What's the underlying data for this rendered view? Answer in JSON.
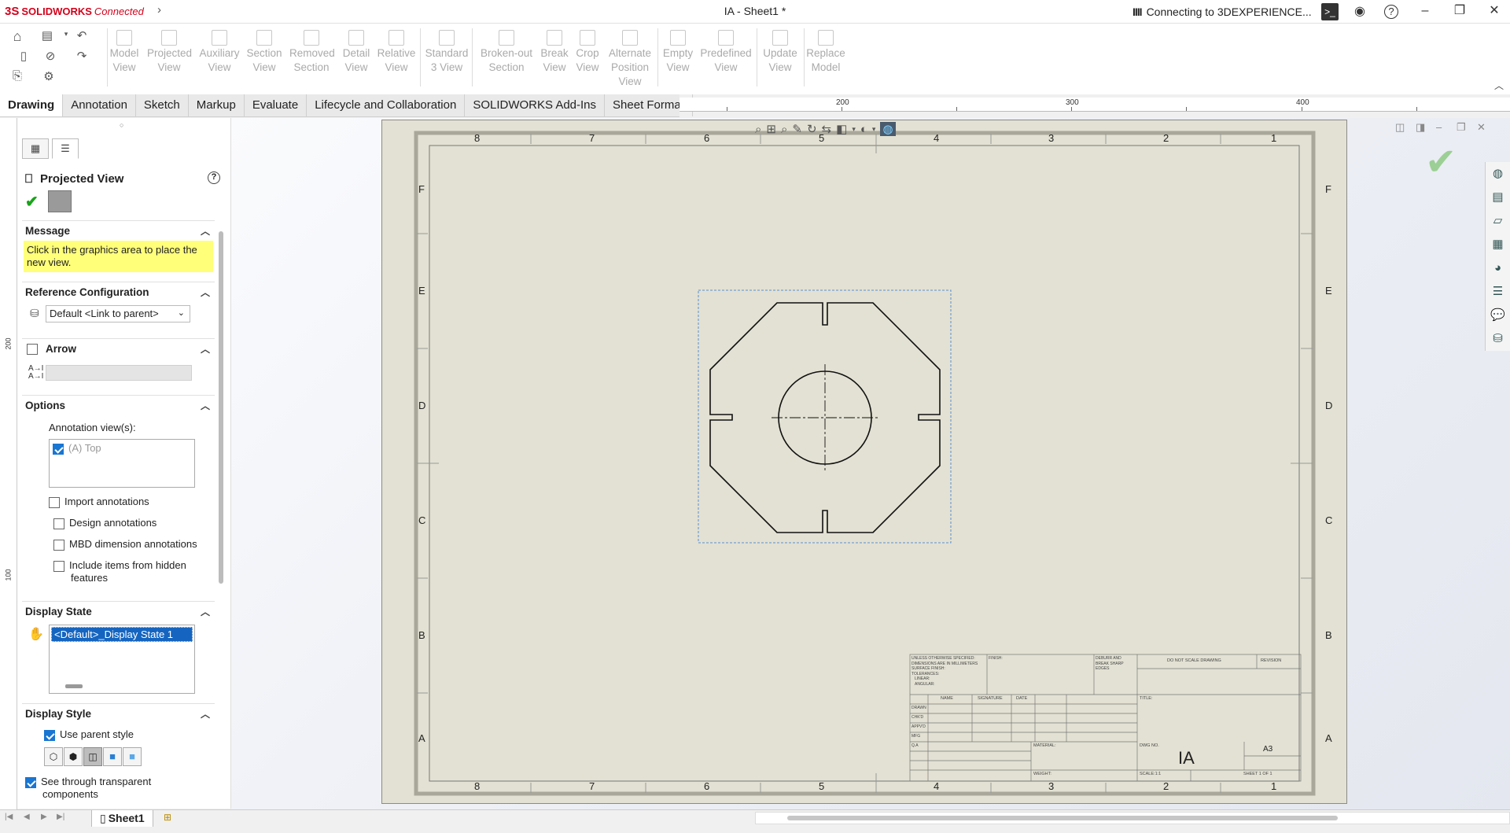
{
  "app": {
    "brand_ds": "3S",
    "brand_solidworks": "SOLIDWORKS",
    "brand_connected": "Connected",
    "document_title": "IA - Sheet1 *",
    "connection_status": "Connecting to 3DEXPERIENCE...",
    "connection_bars": "IIII"
  },
  "toolbar": {
    "tools": [
      {
        "line1": "Model",
        "line2": "View",
        "line3": ""
      },
      {
        "line1": "Projected",
        "line2": "View",
        "line3": ""
      },
      {
        "line1": "Auxiliary",
        "line2": "View",
        "line3": ""
      },
      {
        "line1": "Section",
        "line2": "View",
        "line3": ""
      },
      {
        "line1": "Removed",
        "line2": "Section",
        "line3": ""
      },
      {
        "line1": "Detail",
        "line2": "View",
        "line3": ""
      },
      {
        "line1": "Relative",
        "line2": "View",
        "line3": ""
      },
      {
        "line1": "Standard",
        "line2": "3 View",
        "line3": ""
      },
      {
        "line1": "Broken-out",
        "line2": "Section",
        "line3": ""
      },
      {
        "line1": "Break",
        "line2": "View",
        "line3": ""
      },
      {
        "line1": "Crop",
        "line2": "View",
        "line3": ""
      },
      {
        "line1": "Alternate",
        "line2": "Position",
        "line3": "View"
      },
      {
        "line1": "Empty",
        "line2": "View",
        "line3": ""
      },
      {
        "line1": "Predefined",
        "line2": "View",
        "line3": ""
      },
      {
        "line1": "Update",
        "line2": "View",
        "line3": ""
      },
      {
        "line1": "Replace",
        "line2": "Model",
        "line3": ""
      }
    ]
  },
  "tabs": [
    "Drawing",
    "Annotation",
    "Sketch",
    "Markup",
    "Evaluate",
    "Lifecycle and Collaboration",
    "SOLIDWORKS Add-Ins",
    "Sheet Format"
  ],
  "ruler": {
    "labels": [
      "200",
      "300",
      "400"
    ]
  },
  "vruler": {
    "labels": [
      "200",
      "100"
    ]
  },
  "panel": {
    "title": "Projected View",
    "help": "?",
    "message_header": "Message",
    "message_text": "Click in the graphics area to place the new view.",
    "refconfig_header": "Reference Configuration",
    "refconfig_value": "Default <Link to parent>",
    "arrow_header": "Arrow",
    "options_header": "Options",
    "annotation_views_label": "Annotation view(s):",
    "annotation_view_item": "(A) Top",
    "import_annotations": "Import annotations",
    "design_annotations": "Design annotations",
    "mbd_annotations": "MBD dimension annotations",
    "hidden_items_1": "Include items from hidden",
    "hidden_items_2": "features",
    "display_state_header": "Display State",
    "display_state_value": "<Default>_Display State 1",
    "display_style_header": "Display Style",
    "use_parent_style": "Use parent style",
    "see_through_1": "See through transparent",
    "see_through_2": "components"
  },
  "sheet": {
    "zones_x": [
      "8",
      "7",
      "6",
      "5",
      "4",
      "3",
      "2",
      "1"
    ],
    "zones_y": [
      "F",
      "E",
      "D",
      "C",
      "B",
      "A"
    ],
    "title_block": {
      "unless": "UNLESS OTHERWISE SPECIFIED:",
      "dims": "DIMENSIONS ARE IN MILLIMETERS",
      "surface": "SURFACE FINISH:",
      "tolerances": "TOLERANCES:",
      "linear": "LINEAR:",
      "angular": "ANGULAR:",
      "finish": "FINISH:",
      "deburr1": "DEBURR AND",
      "deburr2": "BREAK SHARP",
      "deburr3": "EDGES",
      "do_not_scale": "DO NOT SCALE DRAWING",
      "revision": "REVISION",
      "name": "NAME",
      "signature": "SIGNATURE",
      "date": "DATE",
      "title": "TITLE:",
      "drawn": "DRAWN",
      "chkd": "CHK'D",
      "appvd": "APPV'D",
      "mfg": "MFG",
      "qa": "Q.A",
      "material": "MATERIAL:",
      "dwg_no": "DWG NO.",
      "dwg_value": "IA",
      "size": "A3",
      "weight": "WEIGHT:",
      "scale": "SCALE:1:1",
      "sheet": "SHEET 1 OF 1"
    }
  },
  "sheet_tab": "Sheet1"
}
